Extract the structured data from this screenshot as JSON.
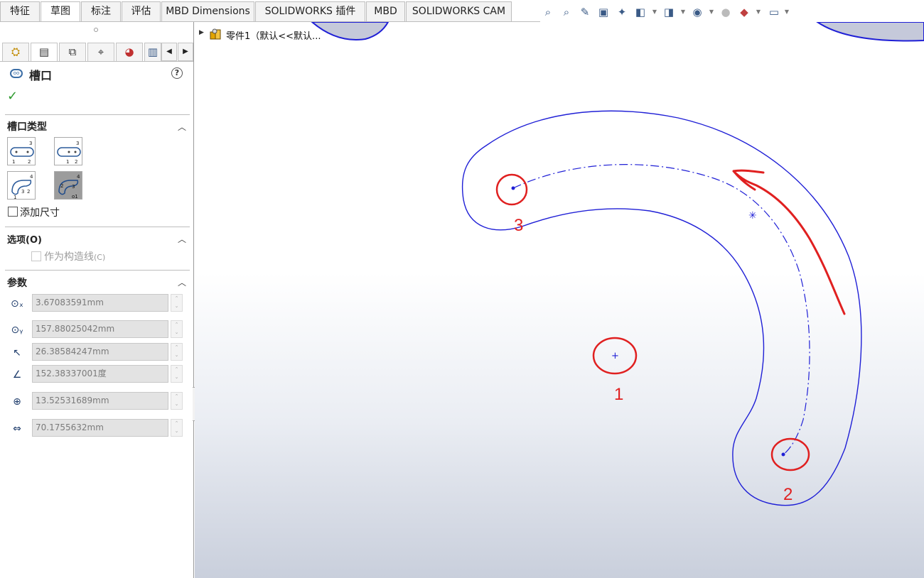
{
  "command_tabs": [
    "特征",
    "草图",
    "标注",
    "评估",
    "MBD Dimensions",
    "SOLIDWORKS 插件",
    "MBD",
    "SOLIDWORKS CAM"
  ],
  "active_tab": "草图",
  "toolbar_icons": [
    "zoom-to-fit-icon",
    "zoom-to-area-icon",
    "previous-view-icon",
    "section-view-icon",
    "dynamic-annotation-icon",
    "view-orientation-icon",
    "display-style-icon",
    "hide-show-icon",
    "edit-appearance-icon",
    "apply-scene-icon",
    "view-settings-icon"
  ],
  "manager_tabs": [
    "featuremanager-icon",
    "propertymanager-icon",
    "configurationmanager-icon",
    "dimxpert-icon",
    "display-manager-icon",
    "cam-icon"
  ],
  "property_manager": {
    "title": "槽口",
    "help_icon": "?",
    "ok_icon": "✓",
    "slot_type": {
      "title": "槽口类型",
      "add_dimensions_label": "添加尺寸",
      "add_dimensions_checked": false,
      "selected_type": "arc-slot-3point-center"
    },
    "options": {
      "title": "选项(O)",
      "construction_label": "作为构造线",
      "construction_shortcut": "(C)"
    },
    "parameters": {
      "title": "参数",
      "fields": [
        {
          "icon": "center-x-icon",
          "value": "3.67083591mm"
        },
        {
          "icon": "center-y-icon",
          "value": "157.88025042mm"
        },
        {
          "icon": "radius-icon",
          "value": "26.38584247mm"
        },
        {
          "icon": "angle-icon",
          "value": "152.38337001度"
        },
        {
          "icon": "slot-width-icon",
          "value": "13.52531689mm"
        },
        {
          "icon": "slot-length-icon",
          "value": "70.1755632mm"
        }
      ]
    }
  },
  "feature_tree": {
    "root_label": "零件1（默认<<默认..."
  },
  "annotations": [
    "1",
    "2",
    "3"
  ],
  "colors": {
    "sketch_blue": "#1f1fd6",
    "annotation_red": "#e02020",
    "ok_green": "#2d9a2d"
  }
}
